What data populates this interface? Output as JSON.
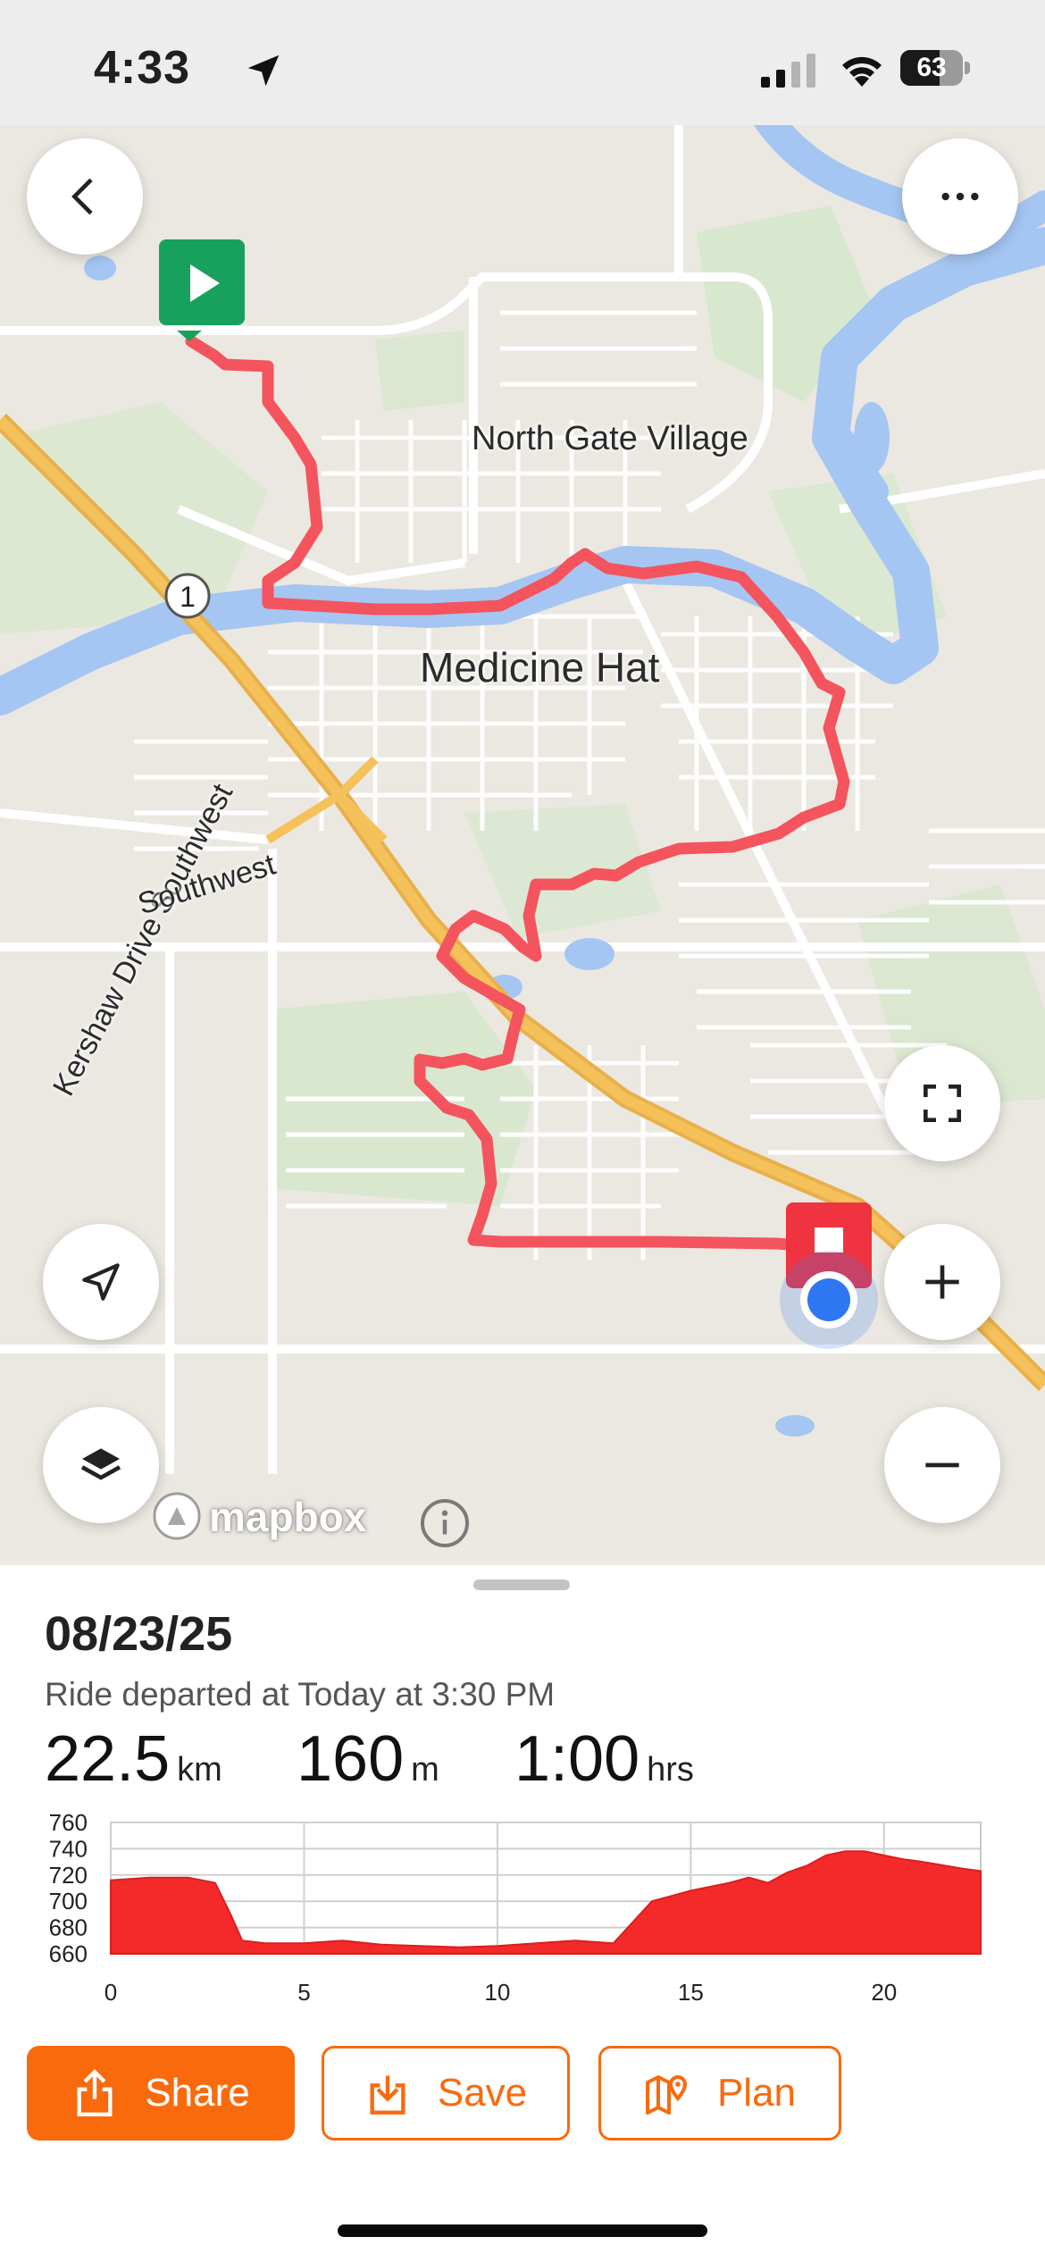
{
  "status_bar": {
    "time": "4:33",
    "battery": "63",
    "icons": [
      "location-arrow-icon",
      "signal-icon",
      "wifi-icon",
      "battery-icon"
    ]
  },
  "map": {
    "labels": {
      "neighborhood": "North Gate Village",
      "city": "Medicine Hat",
      "street1": "Kershaw Drive Southwest",
      "street2": "Southwest",
      "highway_shield": "1"
    },
    "attribution": "mapbox",
    "route_color": "#f4545d",
    "start_marker_color": "#17a15c",
    "end_marker_color": "#ef3340"
  },
  "ride": {
    "date": "08/23/25",
    "subtitle": "Ride departed at Today at 3:30 PM",
    "distance_value": "22.5",
    "distance_unit": "km",
    "elevation_value": "160",
    "elevation_unit": "m",
    "duration_value": "1:00",
    "duration_unit": "hrs"
  },
  "chart_data": {
    "type": "area",
    "ylim": [
      660,
      760
    ],
    "yticks": [
      760,
      740,
      720,
      700,
      680,
      660
    ],
    "xlim": [
      0,
      22.5
    ],
    "xticks": [
      0,
      5,
      10,
      15,
      20
    ],
    "grid": true,
    "color": "#f42a2a",
    "x": [
      0,
      1,
      2,
      2.7,
      3.1,
      3.4,
      4,
      5,
      6,
      7,
      8,
      9,
      10,
      11,
      12,
      13,
      13.5,
      14,
      14.5,
      15,
      16,
      16.5,
      17,
      17.5,
      18,
      18.5,
      19,
      19.5,
      20,
      20.5,
      21,
      22,
      22.5
    ],
    "y": [
      716,
      718,
      718,
      714,
      690,
      670,
      668,
      668,
      670,
      667,
      666,
      665,
      666,
      668,
      670,
      668,
      684,
      700,
      704,
      708,
      714,
      718,
      714,
      722,
      727,
      735,
      738,
      738,
      735,
      732,
      730,
      725,
      723
    ]
  },
  "actions": {
    "share_label": "Share",
    "save_label": "Save",
    "plan_label": "Plan"
  }
}
